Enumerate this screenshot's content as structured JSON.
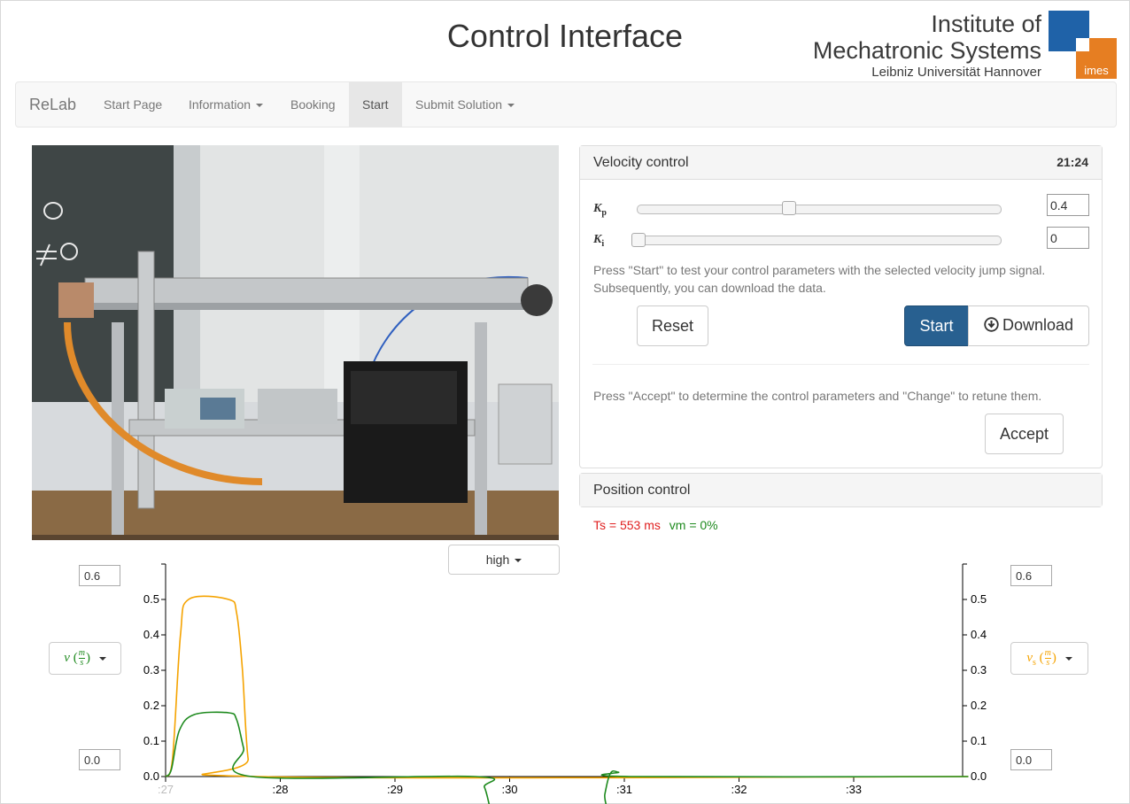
{
  "header": {
    "title": "Control Interface"
  },
  "logo": {
    "line1": "Institute of",
    "line2": "Mechatronic Systems",
    "line3": "Leibniz Universität Hannover",
    "badge": "imes",
    "brand_blue": "#1f62a8",
    "brand_orange": "#e67e22"
  },
  "nav": {
    "brand": "ReLab",
    "items": [
      "Start Page",
      "Information",
      "Booking",
      "Start",
      "Submit Solution"
    ],
    "active": "Start"
  },
  "velocity": {
    "heading": "Velocity control",
    "timer": "21:24",
    "kp_symbol": "K",
    "kp_sub": "p",
    "kp_value": "0.4",
    "kp_slider_fraction": 0.4,
    "ki_symbol": "K",
    "ki_sub": "i",
    "ki_value": "0",
    "ki_slider_fraction": 0.0,
    "hint1": "Press \"Start\" to test your control parameters with the selected velocity jump signal. Subsequently, you can download the data.",
    "reset": "Reset",
    "start": "Start",
    "download": "Download",
    "hint2": "Press \"Accept\" to determine the control parameters and \"Change\" to retune them.",
    "accept": "Accept"
  },
  "position": {
    "heading": "Position control"
  },
  "status": {
    "ts": "Ts = 553 ms",
    "vm": "vm = 0%"
  },
  "plot": {
    "quality": "high",
    "left_max": "0.6",
    "left_min": "0.0",
    "right_max": "0.6",
    "right_min": "0.0",
    "left_select": {
      "var": "v",
      "num": "m",
      "den": "s"
    },
    "right_select": {
      "var": "v",
      "sub": "s",
      "num": "m",
      "den": "s"
    }
  },
  "chart_data": {
    "type": "line",
    "ylim": [
      0,
      0.6
    ],
    "yticks": [
      0.0,
      0.1,
      0.2,
      0.3,
      0.4,
      0.5
    ],
    "ytick_labels": [
      "0.0",
      "0.1",
      "0.2",
      "0.3",
      "0.4",
      "0.5"
    ],
    "xlim": [
      27,
      34
    ],
    "xticks": [
      27,
      28,
      29,
      30,
      31,
      32,
      33
    ],
    "xtick_labels": [
      ":27",
      ":28",
      ":29",
      ":30",
      ":31",
      ":32",
      ":33"
    ],
    "series": [
      {
        "color": "#f5a300",
        "x": [
          27.0,
          27.06,
          27.13,
          27.2,
          27.55,
          27.62,
          27.67,
          27.72,
          27.8,
          34.0
        ],
        "y": [
          0.0,
          0.05,
          0.4,
          0.5,
          0.5,
          0.46,
          0.3,
          0.05,
          0.0,
          0.0
        ]
      },
      {
        "color": "#1e8a1e",
        "x": [
          27.0,
          27.05,
          27.12,
          27.25,
          27.55,
          27.62,
          27.68,
          27.75,
          29.7,
          29.78,
          29.83,
          29.88,
          30.78,
          30.83,
          30.88,
          30.95,
          31.05,
          34.0
        ],
        "y": [
          0.0,
          0.02,
          0.13,
          0.175,
          0.18,
          0.16,
          0.08,
          0.0,
          0.0,
          -0.03,
          -0.09,
          -0.15,
          -0.15,
          -0.05,
          0.01,
          0.012,
          0.0,
          0.0
        ]
      }
    ]
  }
}
